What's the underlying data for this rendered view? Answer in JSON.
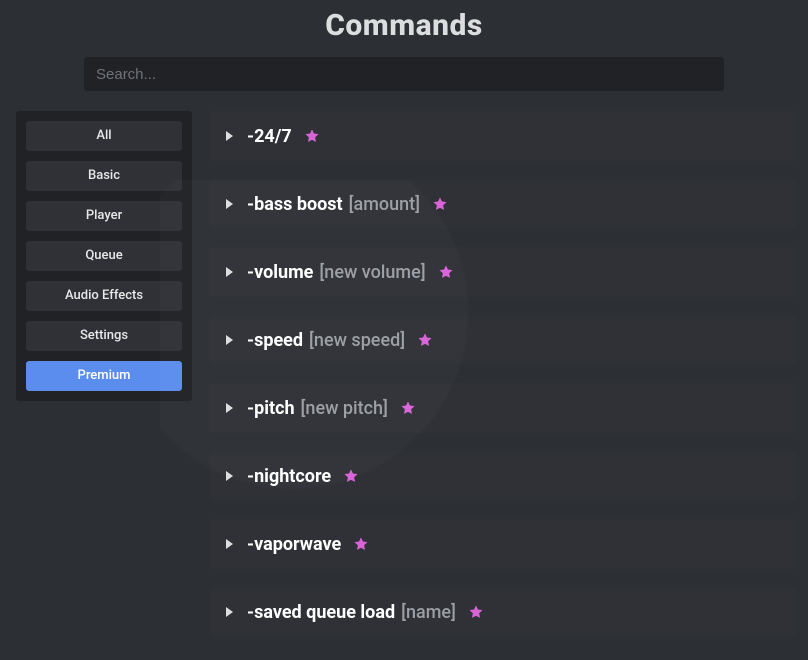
{
  "title": "Commands",
  "search": {
    "placeholder": "Search..."
  },
  "sidebar": {
    "items": [
      {
        "label": "All",
        "selected": false
      },
      {
        "label": "Basic",
        "selected": false
      },
      {
        "label": "Player",
        "selected": false
      },
      {
        "label": "Queue",
        "selected": false
      },
      {
        "label": "Audio Effects",
        "selected": false
      },
      {
        "label": "Settings",
        "selected": false
      },
      {
        "label": "Premium",
        "selected": true
      }
    ]
  },
  "commands": [
    {
      "name": "-24/7",
      "arg": "",
      "premium": true
    },
    {
      "name": "-bass boost",
      "arg": "[amount]",
      "premium": true
    },
    {
      "name": "-volume",
      "arg": "[new volume]",
      "premium": true
    },
    {
      "name": "-speed",
      "arg": "[new speed]",
      "premium": true
    },
    {
      "name": "-pitch",
      "arg": "[new pitch]",
      "premium": true
    },
    {
      "name": "-nightcore",
      "arg": "",
      "premium": true
    },
    {
      "name": "-vaporwave",
      "arg": "",
      "premium": true
    },
    {
      "name": "-saved queue load",
      "arg": "[name]",
      "premium": true
    }
  ],
  "colors": {
    "star": "#d864d8",
    "accent": "#5b8def"
  }
}
